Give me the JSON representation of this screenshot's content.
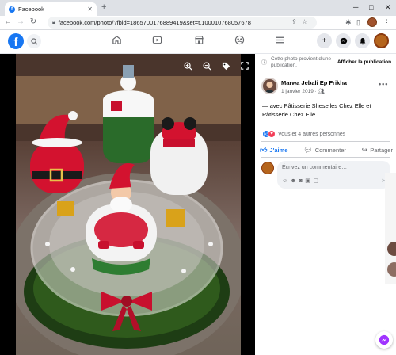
{
  "browser": {
    "tab_title": "Facebook",
    "tab_close": "✕",
    "new_tab": "+",
    "url": "facebook.com/photo/?fbid=1865700176889419&set=t.100010768057678",
    "window_controls": [
      "─",
      "□",
      "✕"
    ]
  },
  "fb_header": {
    "logo_letter": "f",
    "search_icon": "search-icon",
    "nav_icons": [
      "home-icon",
      "watch-icon",
      "marketplace-icon",
      "groups-icon",
      "menu-icon"
    ],
    "right_icons": [
      "plus-icon",
      "messenger-icon",
      "bell-icon"
    ]
  },
  "photo_viewer": {
    "tools": [
      "zoom-in-icon",
      "zoom-out-icon",
      "tag-icon",
      "fullscreen-icon"
    ]
  },
  "panel": {
    "notice_text": "Cette photo provient d'une publication.",
    "notice_button": "Afficher la publication",
    "author_name": "Marwa Jebali Ep Frikha",
    "post_date": "1 janvier 2019 · ",
    "caption": "— avec Pâtisserie Sheselles Chez Elle et Pâtisserie Chez Elle.",
    "reactions_text": "Vous et 4 autres personnes",
    "like_label": "J'aime",
    "comment_label": "Commenter",
    "share_label": "Partager",
    "comment_placeholder": "Écrivez un commentaire…"
  },
  "colors": {
    "fb_blue": "#1877f2",
    "love_red": "#f33e58",
    "text_secondary": "#65676b"
  }
}
